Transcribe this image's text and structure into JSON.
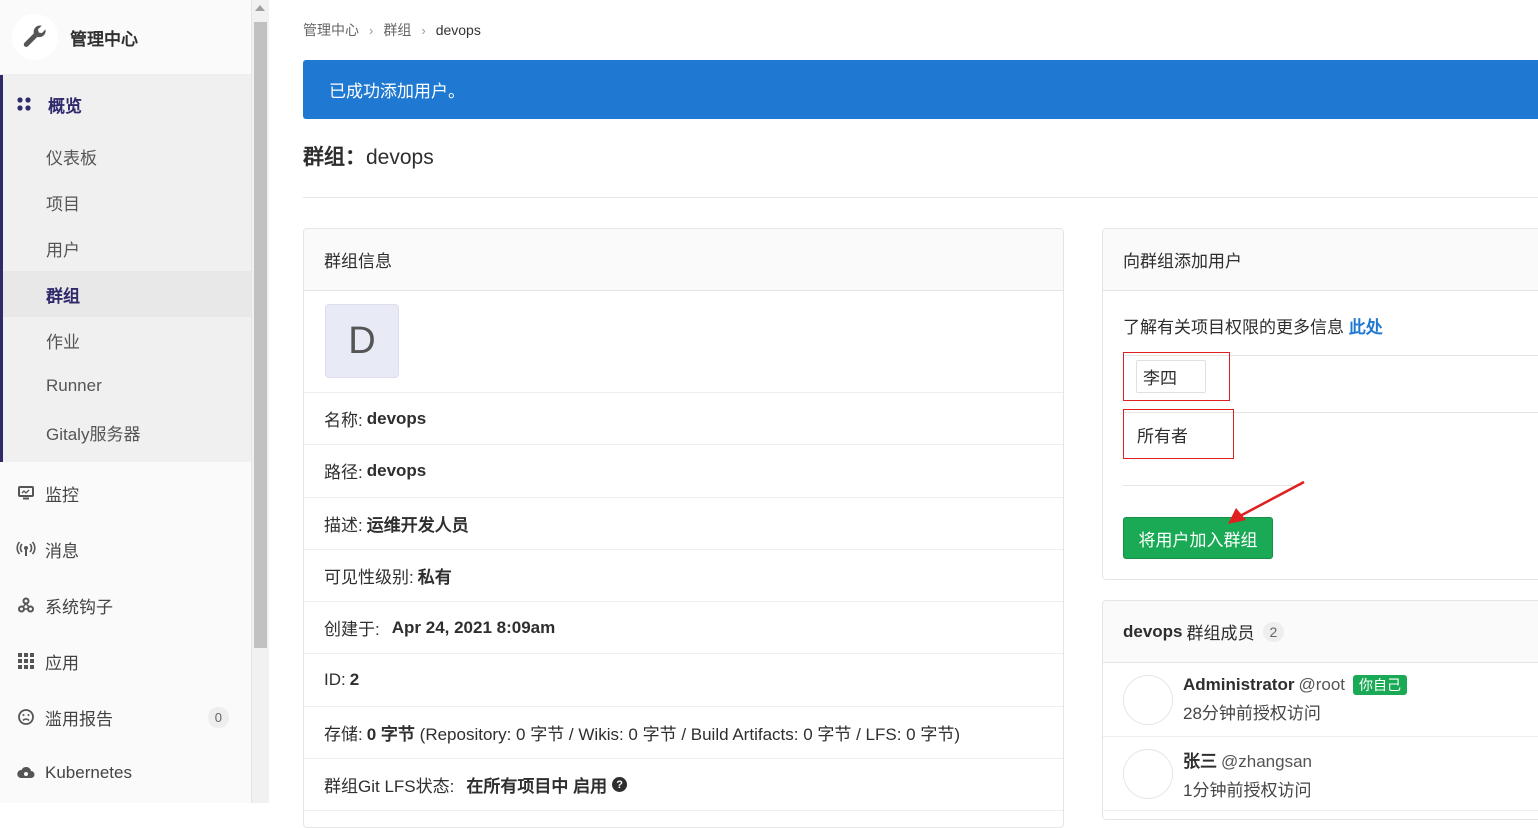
{
  "sidebar": {
    "title": "管理中心",
    "overview": {
      "label": "概览",
      "items": [
        "仪表板",
        "项目",
        "用户",
        "群组",
        "作业",
        "Runner",
        "Gitaly服务器"
      ],
      "active": "群组"
    },
    "nav": [
      {
        "label": "监控",
        "icon": "monitor-icon"
      },
      {
        "label": "消息",
        "icon": "broadcast-icon"
      },
      {
        "label": "系统钩子",
        "icon": "hook-icon"
      },
      {
        "label": "应用",
        "icon": "apps-grid-icon"
      },
      {
        "label": "滥用报告",
        "icon": "frown-icon",
        "count": "0"
      },
      {
        "label": "Kubernetes",
        "icon": "cloud-gear-icon"
      }
    ]
  },
  "breadcrumb": [
    "管理中心",
    "群组",
    "devops"
  ],
  "alert": "已成功添加用户。",
  "page_title": {
    "prefix": "群组：",
    "name": "devops"
  },
  "group_info": {
    "header": "群组信息",
    "avatar_letter": "D",
    "rows": [
      {
        "label": "名称:",
        "value": "devops"
      },
      {
        "label": "路径:",
        "value": "devops"
      },
      {
        "label": "描述:",
        "value": "运维开发人员"
      },
      {
        "label": "可见性级别:",
        "value": "私有"
      },
      {
        "label": "创建于:",
        "value": "Apr 24, 2021 8:09am"
      },
      {
        "label": "ID:",
        "value": "2"
      }
    ],
    "storage": {
      "label": "存储:",
      "value": "0 字节",
      "detail": "(Repository: 0 字节 / Wikis: 0 字节 / Build Artifacts: 0 字节 / LFS: 0 字节)"
    },
    "lfs": {
      "label": "群组Git LFS状态:",
      "value": "在所有项目中 启用",
      "help": "?"
    }
  },
  "add_user": {
    "header": "向群组添加用户",
    "permission_text": "了解有关项目权限的更多信息",
    "permission_link": "此处",
    "selected_user": "李四",
    "selected_role": "所有者",
    "submit": "将用户加入群组"
  },
  "members": {
    "group_name": "devops",
    "title": "群组成员",
    "count": "2",
    "list": [
      {
        "name": "Administrator",
        "handle": "@root",
        "badge": "你自己",
        "access": "28分钟前授权访问"
      },
      {
        "name": "张三",
        "handle": "@zhangsan",
        "badge": "",
        "access": "1分钟前授权访问"
      }
    ]
  },
  "colors": {
    "primary": "#1f78d1",
    "success": "#1aaa55",
    "highlight": "#e02020",
    "sidebar_active": "#2f2a6b"
  }
}
